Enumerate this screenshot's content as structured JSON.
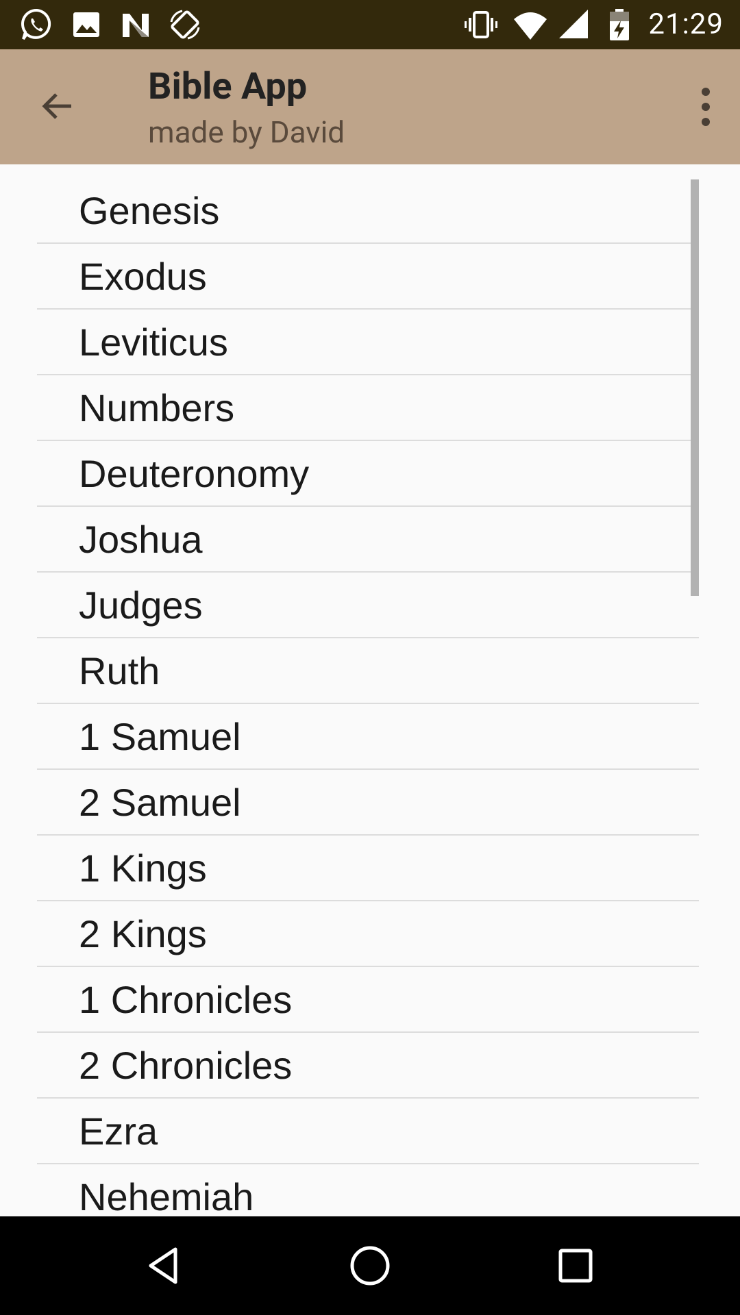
{
  "status_bar": {
    "time": "21:29",
    "left_icons": [
      "whatsapp-icon",
      "image-icon",
      "n-app-icon",
      "screen-rotation-icon"
    ],
    "right_icons": [
      "vibrate-icon",
      "wifi-icon",
      "cellular-signal-icon",
      "battery-charging-icon"
    ],
    "background": "#33290c"
  },
  "app_bar": {
    "title": "Bible App",
    "subtitle": "made by David",
    "background": "#bea48a",
    "back_icon": "arrow-back-icon",
    "menu_icon": "more-vert-icon"
  },
  "books": [
    "Genesis",
    "Exodus",
    "Leviticus",
    "Numbers",
    "Deuteronomy",
    "Joshua",
    "Judges",
    "Ruth",
    "1 Samuel",
    "2 Samuel",
    "1 Kings",
    "2 Kings",
    "1 Chronicles",
    "2 Chronicles",
    "Ezra",
    "Nehemiah"
  ],
  "nav_bar": {
    "buttons": [
      "back-triangle-icon",
      "home-circle-icon",
      "recents-square-icon"
    ]
  }
}
